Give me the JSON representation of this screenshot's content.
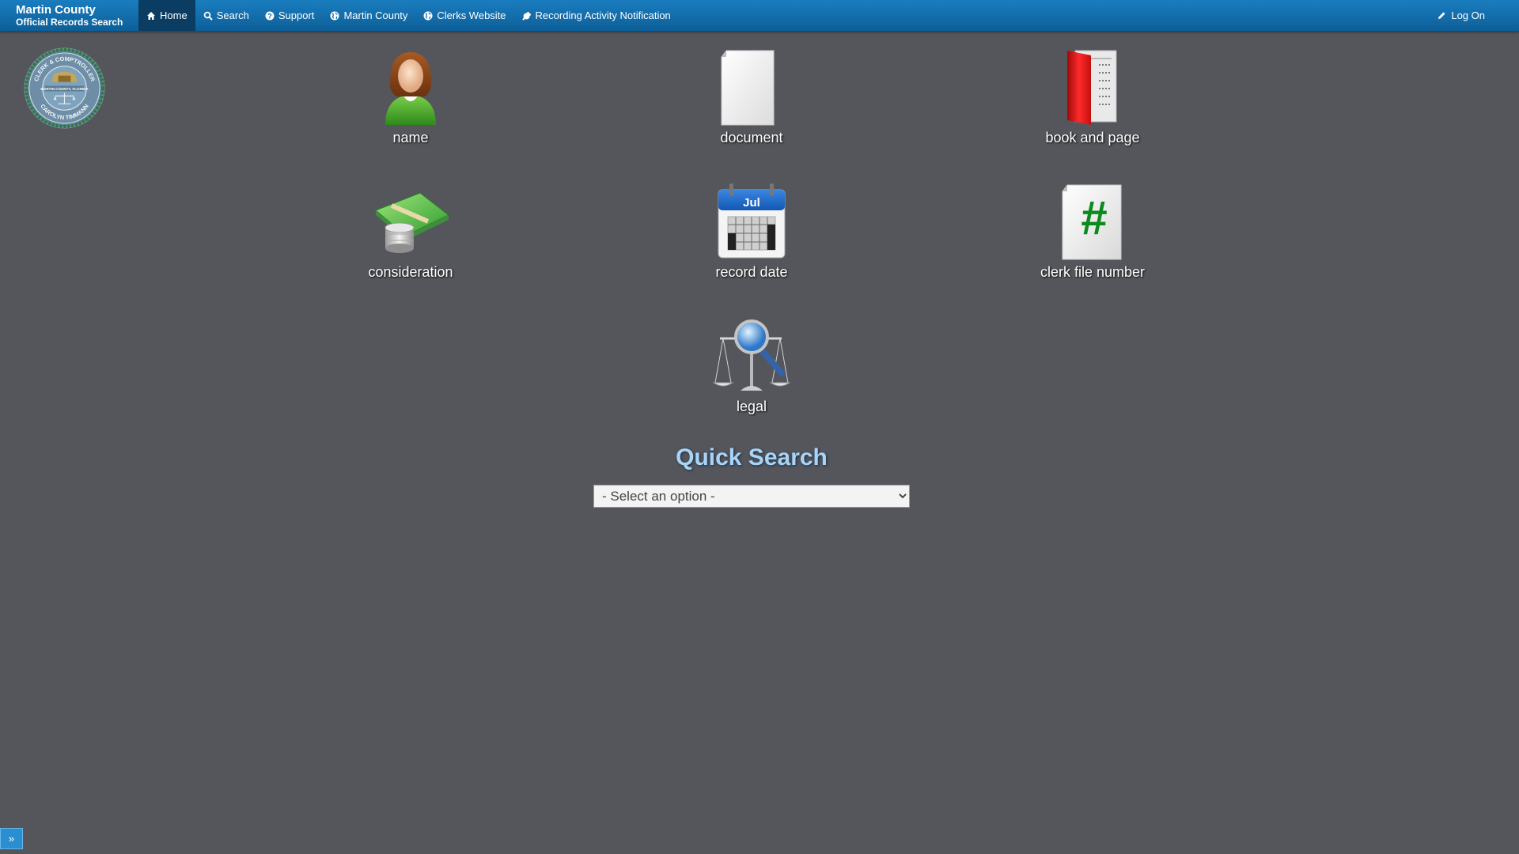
{
  "brand": {
    "line1": "Martin County",
    "line2": "Official Records Search"
  },
  "nav": {
    "home": "Home",
    "search": "Search",
    "support": "Support",
    "martin_county": "Martin County",
    "clerks_website": "Clerks Website",
    "recording_notification": "Recording Activity Notification",
    "logon": "Log On"
  },
  "seal": {
    "top_text": "CLERK & COMPTROLLER",
    "middle_text": "MARTIN COUNTY, FLORIDA",
    "bottom_text": "CAROLYN TIMMANN"
  },
  "tiles": {
    "name": "name",
    "document": "document",
    "book_and_page": "book and page",
    "consideration": "consideration",
    "record_date": "record date",
    "calendar_month": "Jul",
    "clerk_file_number": "clerk file number",
    "legal": "legal"
  },
  "quick_search": {
    "title": "Quick Search",
    "selected_option": "- Select an option -"
  },
  "sidebar_toggle": "»",
  "colors": {
    "background": "#54565c",
    "navbar": "#1a7dbf",
    "active_nav": "#0b3c62",
    "quick_search_title": "#a9d3f7"
  }
}
